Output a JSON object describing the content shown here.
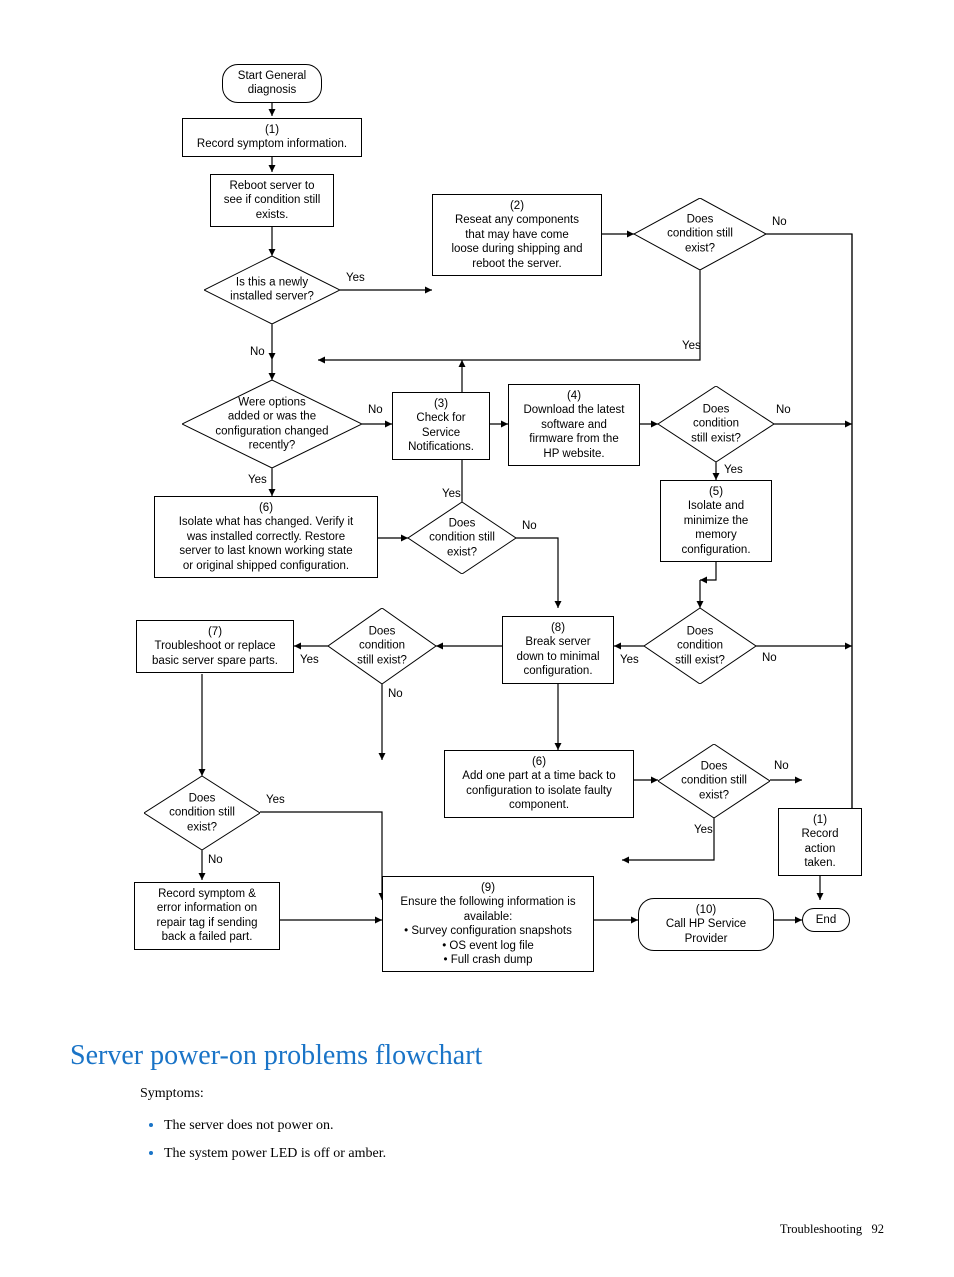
{
  "nodes": {
    "start": "Start General\ndiagnosis",
    "n1": "(1)\nRecord symptom information.",
    "reboot": "Reboot server to\nsee if condition still\nexists.",
    "d_new": "Is this a newly\ninstalled server?",
    "n2": "(2)\nReseat any components\nthat may have come\nloose during shipping and\nreboot the server.",
    "d_c1": "Does\ncondition still\nexist?",
    "d_opt": "Were options\nadded or was the\nconfiguration changed\nrecently?",
    "n3": "(3)\nCheck for\nService\nNotifications.",
    "n4": "(4)\nDownload the latest\nsoftware and\nfirmware from the\nHP website.",
    "d_c2": "Does\ncondition\nstill exist?",
    "n5": "(5)\nIsolate and\nminimize the\nmemory\nconfiguration.",
    "n6": "(6)\nIsolate what has changed. Verify it\nwas installed correctly.  Restore\nserver to last known working state\nor original shipped configuration.",
    "d_c3": "Does\ncondition still\nexist?",
    "n7": "(7)\nTroubleshoot or replace\nbasic server spare parts.",
    "d_c4": "Does\ncondition\nstill exist?",
    "n8": "(8)\nBreak server\ndown to minimal\nconfiguration.",
    "d_c5": "Does\ncondition\nstill exist?",
    "d_c6": "Does\ncondition still\nexist?",
    "n6b": "(6)\nAdd one part at a time back to\nconfiguration to isolate faulty\ncomponent.",
    "d_c7": "Does\ncondition still\nexist?",
    "n1b": "(1)\nRecord action\ntaken.",
    "rec": "Record symptom &\nerror information on\nrepair tag if sending\nback a failed part.",
    "n9": "(9)\nEnsure the following information is\navailable:\n• Survey configuration snapshots\n• OS event log file\n• Full crash dump",
    "n10": "(10)\nCall HP Service\nProvider",
    "end": "End"
  },
  "edge_labels": {
    "yes": "Yes",
    "no": "No"
  },
  "section_title": "Server power-on problems flowchart",
  "symptoms_label": "Symptoms:",
  "symptoms": [
    "The server does not power on.",
    "The system power LED is off or amber."
  ],
  "footer_section": "Troubleshooting",
  "footer_page": "92"
}
